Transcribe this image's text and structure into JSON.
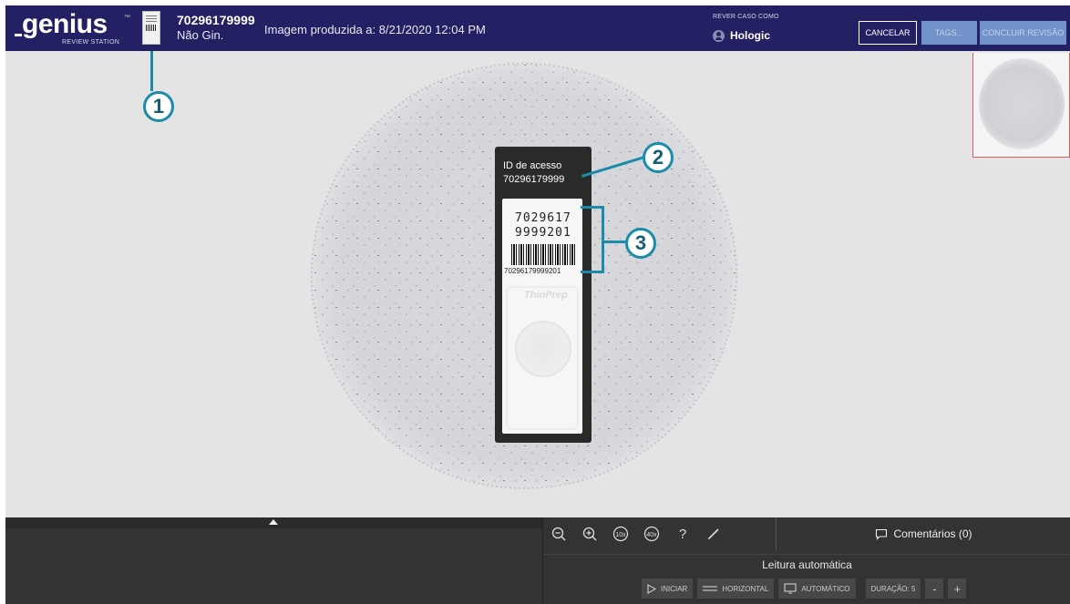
{
  "header": {
    "logo": "genius",
    "logo_tm": "™",
    "logo_sub": "REVIEW STATION",
    "case_id": "70296179999",
    "case_type": "Não Gin.",
    "image_date": "Imagem produzida a: 8/21/2020 12:04 PM",
    "review_as_label": "REVER CASO COMO",
    "review_as_name": "Hologic",
    "buttons": {
      "cancel": "CANCELAR",
      "tags": "TAGS...",
      "finish": "CONCLUIR REVISÃO"
    }
  },
  "accession": {
    "label": "ID de acesso",
    "value": "70296179999",
    "handwritten_line1": "7029617",
    "handwritten_line2": "9999201",
    "barcode_text": "70296179999201",
    "brand": "ThinPrep"
  },
  "callouts": [
    "1",
    "2",
    "3"
  ],
  "bottom": {
    "tools": [
      "zoom-out-icon",
      "zoom-in-icon",
      "zoom-10x-icon",
      "zoom-40x-icon",
      "help-icon",
      "pen-icon"
    ],
    "tool_labels": {
      "zoom10": "10x",
      "zoom40": "40x",
      "help": "?"
    },
    "comments": "Comentários (0)",
    "autoread_title": "Leitura automática",
    "controls": {
      "start": "INICIAR",
      "horizontal": "HORIZONTAL",
      "automatic": "AUTOMÁTICO",
      "duration": "DURAÇÃO: 5",
      "minus": "-",
      "plus": "+"
    }
  },
  "colors": {
    "header_bg": "#232164",
    "accent": "#1a8ca9",
    "disabled_button": "#7193c9",
    "panel_bg": "#333333"
  }
}
